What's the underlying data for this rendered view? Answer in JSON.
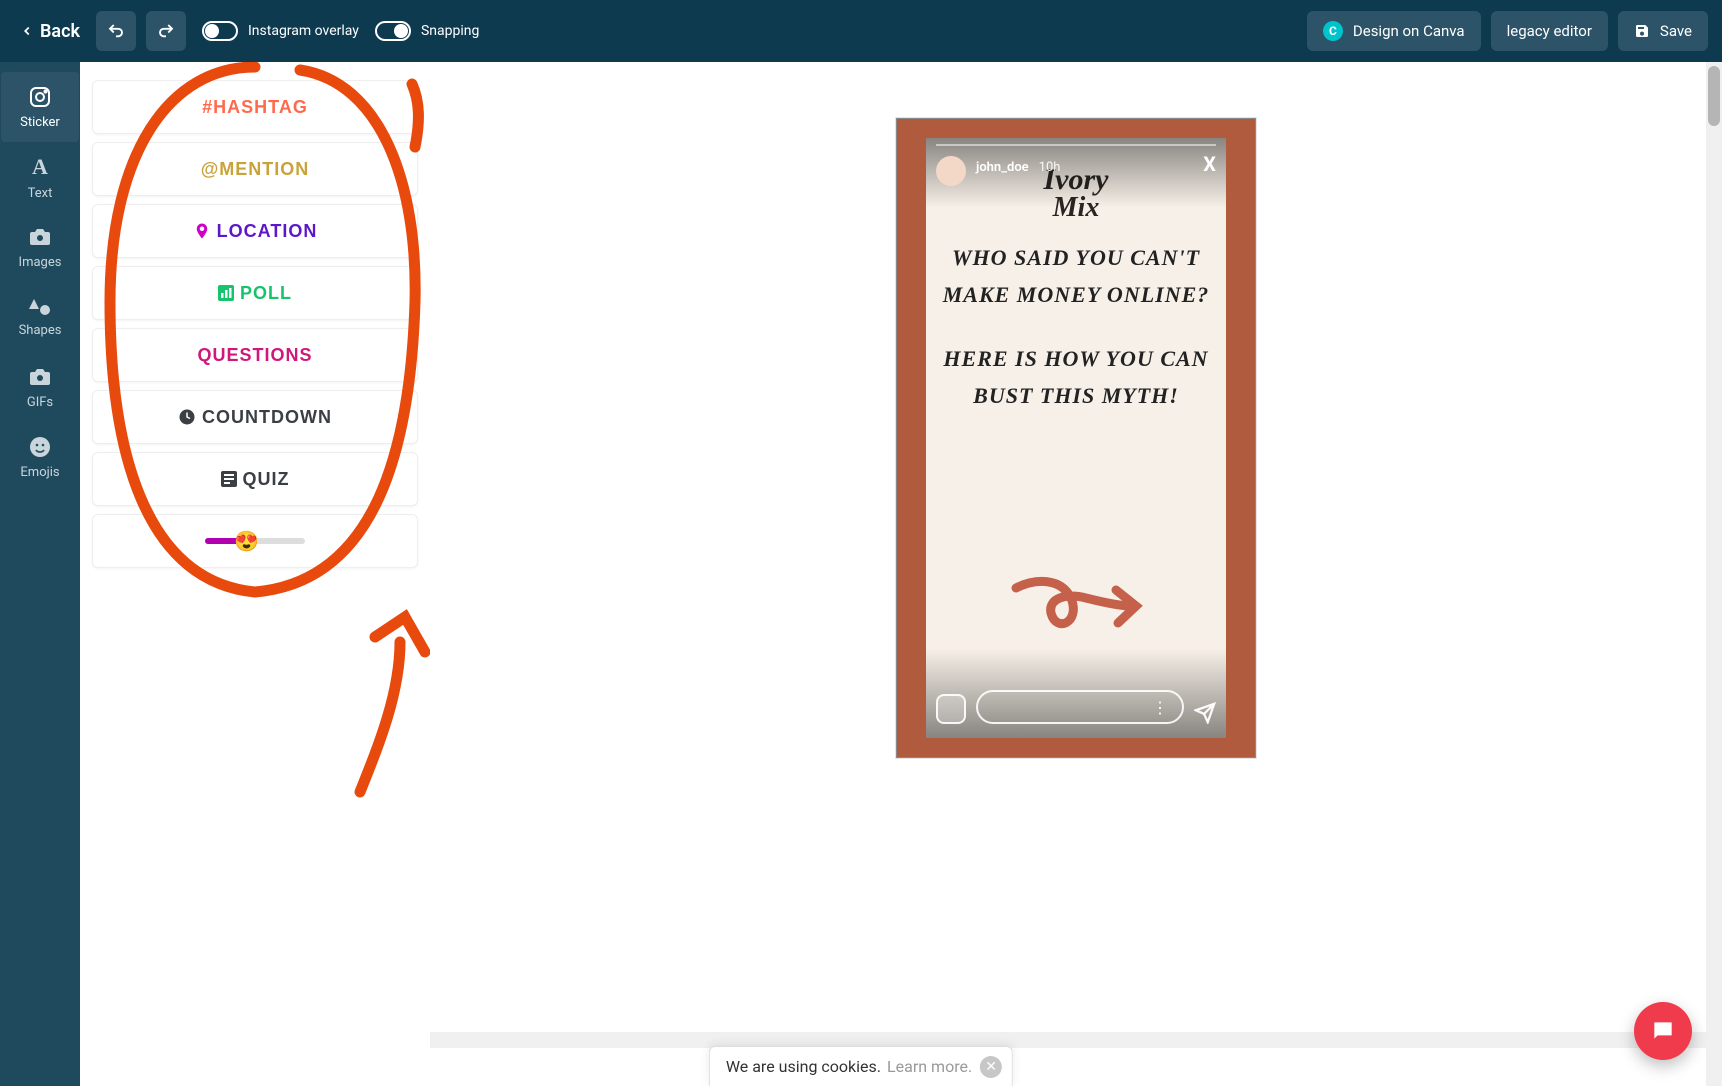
{
  "topbar": {
    "back": "Back",
    "toggles": [
      {
        "label": "Instagram overlay",
        "on": false
      },
      {
        "label": "Snapping",
        "on": true
      }
    ],
    "canva": "Design on Canva",
    "legacy": "legacy editor",
    "save": "Save"
  },
  "rail": [
    {
      "label": "Sticker",
      "icon": "instagram-icon",
      "active": true
    },
    {
      "label": "Text",
      "icon": "text-icon"
    },
    {
      "label": "Images",
      "icon": "camera-icon"
    },
    {
      "label": "Shapes",
      "icon": "shapes-icon"
    },
    {
      "label": "GIFs",
      "icon": "camera-icon"
    },
    {
      "label": "Emojis",
      "icon": "emoji-icon"
    }
  ],
  "stickers": [
    {
      "name": "hashtag",
      "label": "#HASHTAG",
      "color": "#ff6a4d"
    },
    {
      "name": "mention",
      "label": "@MENTION",
      "color": "#c9a339"
    },
    {
      "name": "location",
      "label": "LOCATION",
      "color": "#5b17c9",
      "icon": "pin-icon",
      "iconColor": "#d100c9"
    },
    {
      "name": "poll",
      "label": "POLL",
      "color": "#17c46b",
      "icon": "chart-icon",
      "iconColor": "#17c46b"
    },
    {
      "name": "questions",
      "label": "QUESTIONS",
      "color": "#d0177b"
    },
    {
      "name": "countdown",
      "label": "COUNTDOWN",
      "color": "#3b3f44",
      "icon": "clock-icon",
      "iconColor": "#3b3f44"
    },
    {
      "name": "quiz",
      "label": "QUIZ",
      "color": "#3b3f44",
      "icon": "list-icon",
      "iconColor": "#3b3f44"
    },
    {
      "name": "slider",
      "label": "",
      "type": "slider",
      "emoji": "😍"
    }
  ],
  "story": {
    "user": "john_doe",
    "time": "10h",
    "brand_line1": "Ivory",
    "brand_line2": "Mix",
    "text1": "Who said you can't make money online?",
    "text2": "Here is how you can bust this myth!"
  },
  "cookie": {
    "text": "We are using cookies.",
    "link": "Learn more."
  },
  "colors": {
    "annotation": "#e84a0e",
    "story_border": "#b05a3e",
    "chat_fab": "#ef3b4c"
  }
}
